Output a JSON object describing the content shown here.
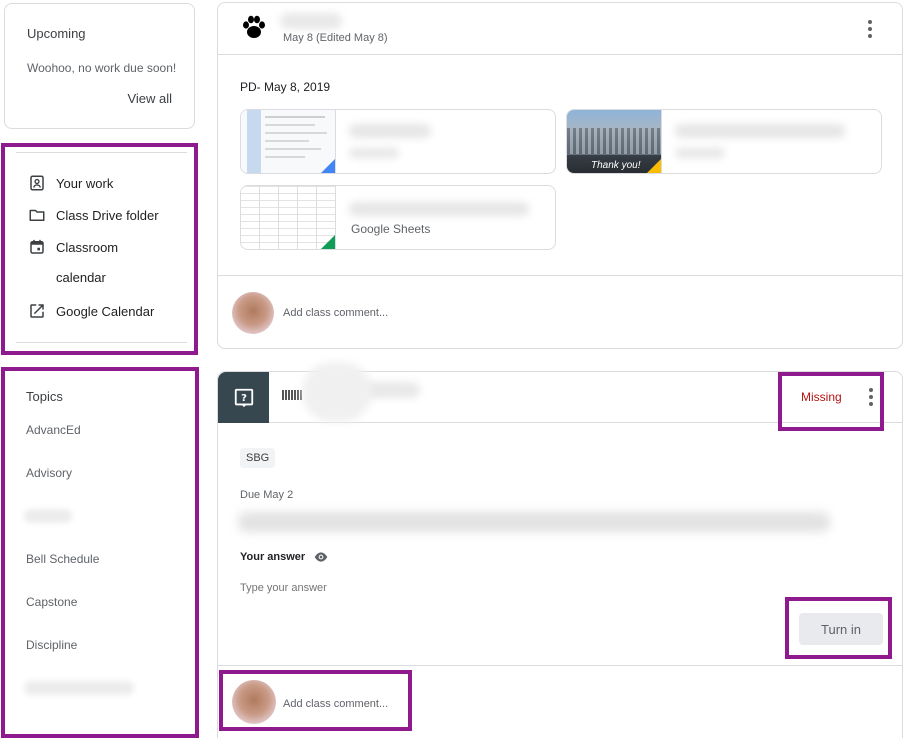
{
  "upcoming": {
    "title": "Upcoming",
    "message": "Woohoo, no work due soon!",
    "view_all": "View all"
  },
  "links": [
    {
      "label": "Your work",
      "icon": "assignment-ind-icon"
    },
    {
      "label": "Class Drive folder",
      "icon": "folder-icon"
    },
    {
      "label": "Classroom",
      "icon": "calendar-icon"
    },
    {
      "label": "calendar",
      "icon": ""
    },
    {
      "label": "Google Calendar",
      "icon": "open-in-new-icon"
    }
  ],
  "topics": {
    "title": "Topics",
    "items": [
      "AdvancEd",
      "Advisory",
      "Bell Schedule",
      "Capstone",
      "Discipline"
    ]
  },
  "post1": {
    "date": "May 8 (Edited May 8)",
    "title": "PD- May 8, 2019",
    "attachments": [
      {
        "type_label": "",
        "thumb_text": "",
        "corner_color": "#4285f4"
      },
      {
        "type_label": "",
        "thumb_text": "Thank you!",
        "corner_color": "#fbbc04"
      },
      {
        "type_label": "Google Sheets",
        "thumb_text": "",
        "corner_color": "#0f9d58"
      }
    ],
    "comment_placeholder": "Add class comment..."
  },
  "post2": {
    "status": "Missing",
    "chip": "SBG",
    "due": "Due May 2",
    "your_answer_label": "Your answer",
    "answer_placeholder": "Type your answer",
    "turn_in": "Turn in",
    "comment_placeholder": "Add class comment..."
  },
  "colors": {
    "highlight": "#8e1a8e",
    "missing": "#b31412",
    "question_icon_bg": "#37474f"
  }
}
